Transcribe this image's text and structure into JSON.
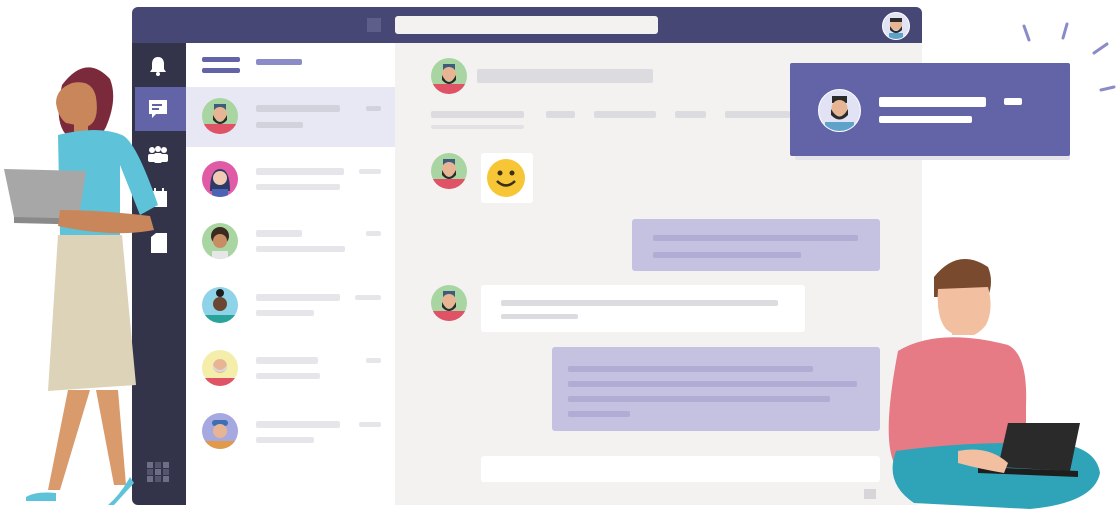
{
  "colors": {
    "brand_dark": "#464775",
    "brand_accent": "#6264a7",
    "rail": "#33344a",
    "chat_bg": "#f3f2f1",
    "my_bubble": "#c5c1e0",
    "selected_row": "#e8e8f4"
  },
  "top_bar": {
    "search_value": "",
    "profile_avatar": "bearded-man-avatar"
  },
  "left_rail": {
    "items": [
      {
        "icon": "bell-icon"
      },
      {
        "icon": "chat-icon",
        "active": true
      },
      {
        "icon": "teams-icon"
      },
      {
        "icon": "calendar-icon"
      },
      {
        "icon": "files-icon"
      },
      {
        "icon": "apps-icon"
      }
    ]
  },
  "chat_list": {
    "rows": [
      {
        "avatar": "bearded-man-avatar",
        "selected": true
      },
      {
        "avatar": "woman-avatar-pink"
      },
      {
        "avatar": "curly-hair-avatar"
      },
      {
        "avatar": "woman-avatar-bun"
      },
      {
        "avatar": "old-man-avatar"
      },
      {
        "avatar": "cap-man-avatar"
      }
    ]
  },
  "conversation": {
    "header_avatar": "bearded-man-avatar",
    "messages": [
      {
        "from": "other",
        "content": "smiley-emoji"
      },
      {
        "from": "me",
        "lines": 2
      },
      {
        "from": "other",
        "lines": 2
      },
      {
        "from": "me",
        "lines": 4
      }
    ]
  },
  "notification": {
    "avatar": "bearded-man-avatar"
  }
}
